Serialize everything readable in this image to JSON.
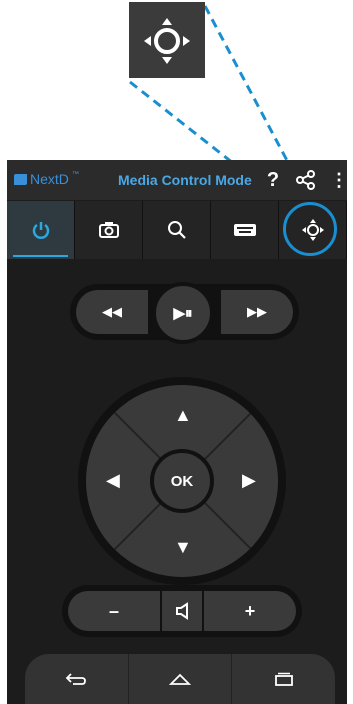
{
  "app": {
    "logo_text": "NextD",
    "logo_tm": "™",
    "title": "Media Control Mode"
  },
  "actionbar": {
    "help_label": "?",
    "more_label": "⋮"
  },
  "toolbar": {
    "items": [
      {
        "name": "power",
        "icon": "power-icon",
        "active": true
      },
      {
        "name": "camera",
        "icon": "camera-icon"
      },
      {
        "name": "search",
        "icon": "search-icon"
      },
      {
        "name": "keyboard",
        "icon": "keyboard-icon"
      },
      {
        "name": "dpad",
        "icon": "dpad-icon"
      }
    ]
  },
  "transport": {
    "rewind": "◀◀",
    "play_pause": "▶⏸",
    "fast_forward": "▶▶"
  },
  "dpad": {
    "up": "▲",
    "down": "▼",
    "left": "◀",
    "right": "▶",
    "ok": "OK"
  },
  "volume": {
    "minus": "–",
    "mute_icon": "speaker-icon",
    "plus": "+"
  },
  "nav": {
    "back": "back-icon",
    "home": "home-icon",
    "recents": "recents-icon"
  },
  "colors": {
    "accent": "#2aa8df",
    "highlight": "#1a8fd0",
    "brand": "#3a8fd9"
  }
}
